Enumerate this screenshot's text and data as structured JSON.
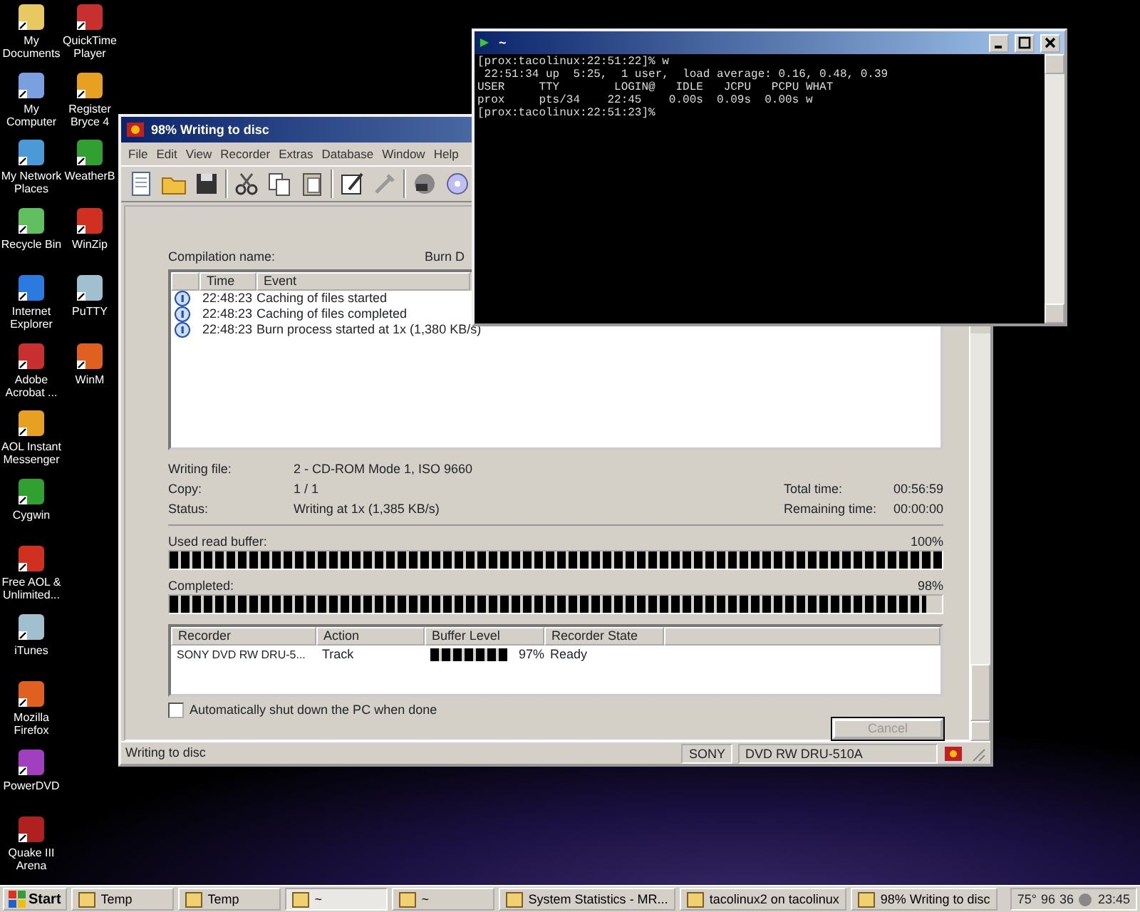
{
  "desktop_icon_columns": [
    [
      {
        "label": "My Documents"
      },
      {
        "label": "My Computer"
      },
      {
        "label": "My Network Places"
      },
      {
        "label": "Recycle Bin"
      },
      {
        "label": "Internet Explorer"
      },
      {
        "label": "Adobe Acrobat ..."
      },
      {
        "label": "AOL Instant Messenger"
      },
      {
        "label": "Cygwin"
      },
      {
        "label": "Free AOL & Unlimited..."
      },
      {
        "label": "iTunes"
      },
      {
        "label": "Mozilla Firefox"
      },
      {
        "label": "PowerDVD"
      },
      {
        "label": "Quake III Arena"
      }
    ],
    [
      {
        "label": "QuickTime Player"
      },
      {
        "label": "Register Bryce 4"
      },
      {
        "label": "WeatherB"
      },
      {
        "label": "WinZip"
      },
      {
        "label": "PuTTY"
      },
      {
        "label": "WinM"
      }
    ]
  ],
  "burn_window": {
    "title": "98% Writing to disc",
    "menu": [
      "File",
      "Edit",
      "View",
      "Recorder",
      "Extras",
      "Database",
      "Window",
      "Help"
    ],
    "compilation_label": "Compilation name:",
    "compilation_value": "Burn D",
    "log": {
      "columns": [
        "Time",
        "Event"
      ],
      "rows": [
        {
          "time": "22:48:23",
          "event": "Caching of files started"
        },
        {
          "time": "22:48:23",
          "event": "Caching of files completed"
        },
        {
          "time": "22:48:23",
          "event": "Burn process started at 1x (1,380 KB/s)"
        }
      ]
    },
    "info_left": [
      {
        "label": "Writing file:",
        "value": "2 - CD-ROM Mode 1, ISO 9660"
      },
      {
        "label": "Copy:",
        "value": "1 / 1"
      },
      {
        "label": "Status:",
        "value": "Writing at 1x (1,385 KB/s)"
      }
    ],
    "info_right": [
      {
        "label": "Total time:",
        "value": "00:56:59"
      },
      {
        "label": "Remaining time:",
        "value": "00:00:00"
      }
    ],
    "progress": [
      {
        "label": "Used read buffer:",
        "reading": "100%",
        "level": 1.0
      },
      {
        "label": "Completed:",
        "reading": "98%",
        "level": 0.98
      }
    ],
    "recorders": {
      "columns": [
        "Recorder",
        "Action",
        "Buffer Level",
        "Recorder State"
      ],
      "rows": [
        {
          "recorder": "SONY DVD RW DRU-5...",
          "action": "Track",
          "level": 0.97,
          "reading": "97%",
          "state": "Ready"
        }
      ]
    },
    "shutdown_checkbox": {
      "label": "Automatically shut down the PC when done",
      "checked": false
    },
    "cancel_button": {
      "label": "Cancel",
      "disabled": true
    },
    "status_bar": {
      "text": "Writing to disc",
      "vendor": "SONY",
      "drive": "DVD RW DRU-510A"
    }
  },
  "terminal": {
    "title": "~",
    "lines": [
      "[prox:tacolinux:22:51:22]% w",
      " 22:51:34 up  5:25,  1 user,  load average: 0.16, 0.48, 0.39",
      "USER     TTY        LOGIN@   IDLE   JCPU   PCPU WHAT",
      "prox     pts/34    22:45    0.00s  0.09s  0.00s w",
      "[prox:tacolinux:22:51:23]%"
    ]
  },
  "taskbar": {
    "start": "Start",
    "tasks": [
      {
        "label": "Temp",
        "selected": false
      },
      {
        "label": "Temp",
        "selected": false
      },
      {
        "label": "~",
        "selected": true
      },
      {
        "label": "~",
        "selected": false
      },
      {
        "label": "System Statistics - MR...",
        "selected": false
      },
      {
        "label": "tacolinux2 on tacolinux",
        "selected": false
      },
      {
        "label": "98% Writing to disc",
        "selected": false
      }
    ],
    "tray": [
      "75°",
      "96",
      "36"
    ],
    "clock": "23:45"
  }
}
